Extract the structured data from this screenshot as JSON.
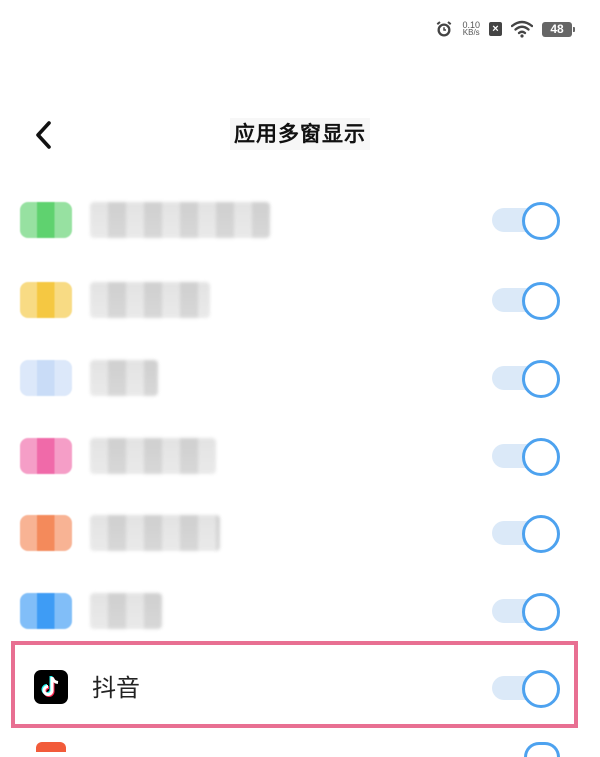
{
  "status_bar": {
    "net_speed_value": "0.10",
    "net_speed_unit": "KB/s",
    "sim_symbol": "×",
    "battery_level": "48",
    "icons": [
      "alarm-icon",
      "no-sim-icon",
      "wifi-icon",
      "battery-icon"
    ]
  },
  "header": {
    "title": "应用多窗显示",
    "back_icon": "chevron-left-icon"
  },
  "apps": [
    {
      "name": "",
      "icon_color": "#5fd26f",
      "enabled": true,
      "name_width": 180
    },
    {
      "name": "",
      "icon_color": "#f5c842",
      "enabled": true,
      "name_width": 120
    },
    {
      "name": "",
      "icon_color": "#c9dcf7",
      "enabled": true,
      "name_width": 68
    },
    {
      "name": "",
      "icon_color": "#f06aa9",
      "enabled": true,
      "name_width": 126
    },
    {
      "name": "",
      "icon_color": "#f48a5b",
      "enabled": true,
      "name_width": 130
    },
    {
      "name": "",
      "icon_color": "#3e9cf5",
      "enabled": true,
      "name_width": 72
    }
  ],
  "highlighted_app": {
    "name": "抖音",
    "enabled": true,
    "icon": "douyin-icon"
  },
  "colors": {
    "toggle_on_border": "#4da2ef",
    "toggle_on_track": "#dbe9f8",
    "highlight_border": "#e86f92"
  }
}
